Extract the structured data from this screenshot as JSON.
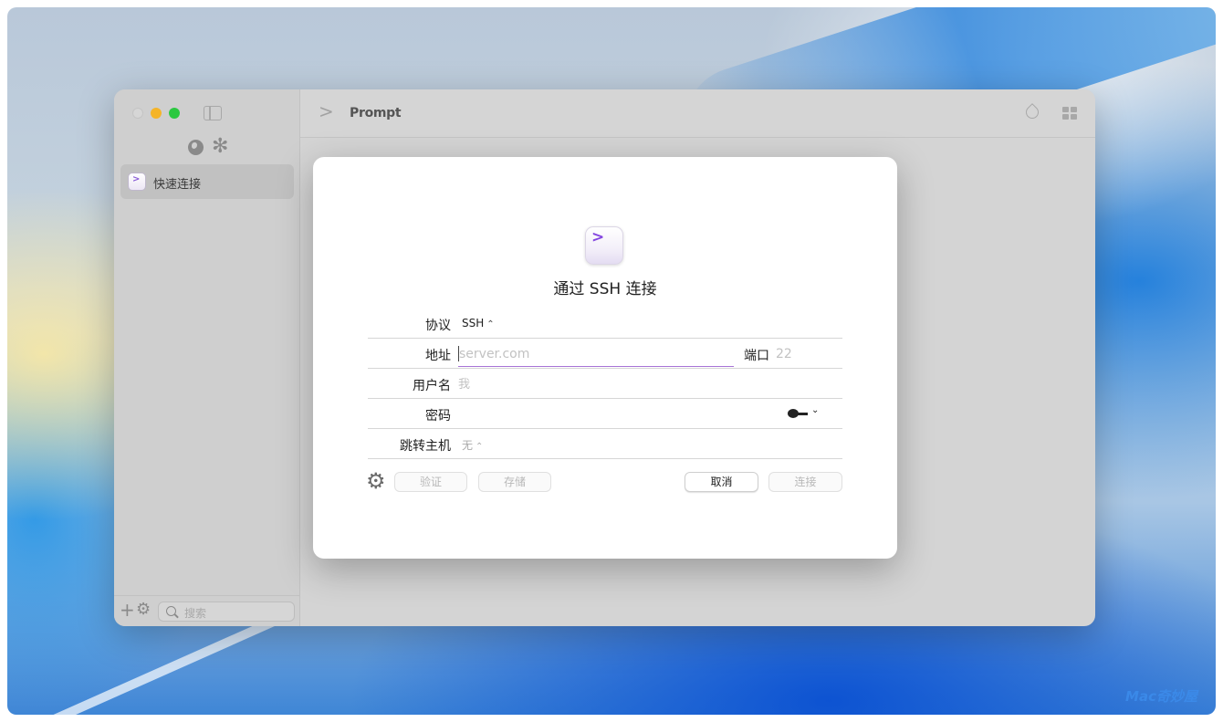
{
  "window": {
    "title": "Prompt"
  },
  "sidebar": {
    "items": [
      {
        "label": "快速连接"
      }
    ],
    "search": {
      "placeholder": "搜索"
    }
  },
  "sheet": {
    "title": "通过 SSH 连接",
    "fields": {
      "protocol": {
        "label": "协议",
        "value": "SSH"
      },
      "address": {
        "label": "地址",
        "placeholder": "server.com",
        "value": ""
      },
      "port": {
        "label": "端口",
        "placeholder": "22"
      },
      "username": {
        "label": "用户名",
        "placeholder": "我"
      },
      "password": {
        "label": "密码"
      },
      "jump_host": {
        "label": "跳转主机",
        "value": "无"
      }
    },
    "buttons": {
      "verify": "验证",
      "save": "存储",
      "cancel": "取消",
      "connect": "连接"
    }
  },
  "watermark": "Mac奇妙屋",
  "colors": {
    "accent": "#8547e0",
    "focus_underline": "#a774d6"
  },
  "icons": [
    "globe-icon",
    "asterisk-icon",
    "sidebar-toggle-icon",
    "drop-icon",
    "grid-icon",
    "key-icon",
    "gear-icon",
    "search-icon",
    "plus-icon"
  ]
}
